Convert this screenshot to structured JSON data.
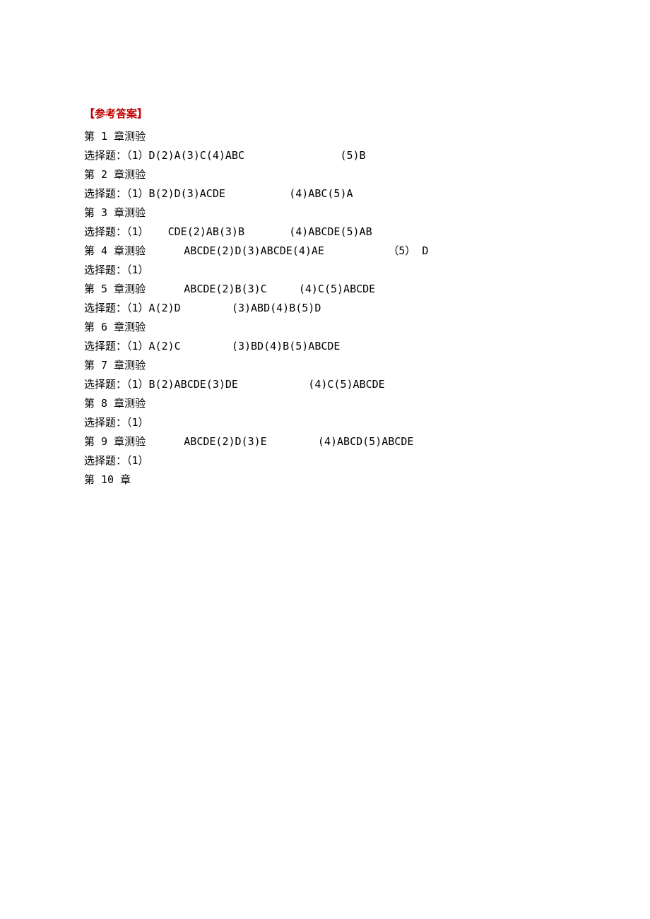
{
  "title": "【参考答案】",
  "lines": [
    "第 1 章测验",
    "选择题：（1）D(2)A(3)C(4)ABC               (5)B",
    "第 2 章测验",
    "选择题：（1）B(2)D(3)ACDE          (4)ABC(5)A",
    "第 3 章测验",
    "选择题：（1）   CDE(2)AB(3)B       (4)ABCDE(5)AB",
    "第 4 章测验      ABCDE(2)D(3)ABCDE(4)AE          （5） D",
    "选择题：（1）",
    "第 5 章测验      ABCDE(2)B(3)C     (4)C(5)ABCDE",
    "选择题：（1）A(2)D        (3)ABD(4)B(5)D",
    "第 6 章测验",
    "选择题：（1）A(2)C        (3)BD(4)B(5)ABCDE",
    "第 7 章测验",
    "选择题：（1）B(2)ABCDE(3)DE           (4)C(5)ABCDE",
    "第 8 章测验",
    "选择题：（1）",
    "第 9 章测验      ABCDE(2)D(3)E        (4)ABCD(5)ABCDE",
    "选择题：（1）",
    "第 10 章"
  ]
}
